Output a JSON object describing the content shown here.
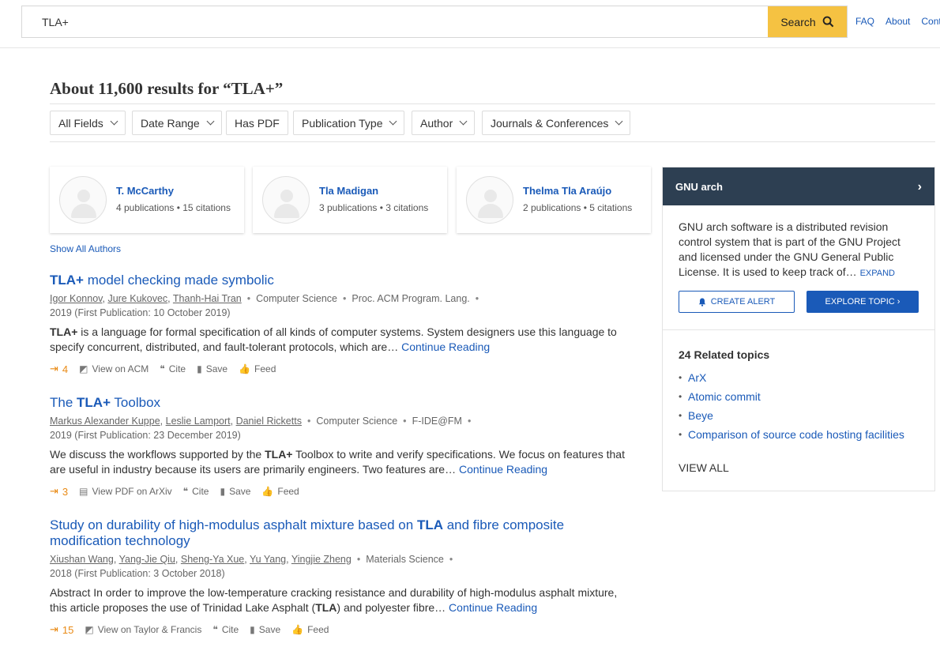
{
  "search": {
    "value": "TLA+",
    "button_label": "Search"
  },
  "topnav": [
    "FAQ",
    "About",
    "Cont"
  ],
  "results_heading": "About 11,600 results for “TLA+”",
  "filters": [
    "All Fields",
    "Date Range",
    "Has PDF",
    "Publication Type",
    "Author",
    "Journals & Conferences"
  ],
  "authors": [
    {
      "name": "T. McCarthy",
      "stats": "4 publications • 15 citations"
    },
    {
      "name": "Tla Madigan",
      "stats": "3 publications • 3 citations"
    },
    {
      "name": "Thelma Tla Araújo",
      "stats": "2 publications • 5 citations"
    }
  ],
  "show_all_authors": "Show All Authors",
  "results": [
    {
      "title_hl": "TLA+",
      "title_rest": " model checking made symbolic",
      "authors": [
        "Igor Konnov",
        "Jure Kukovec",
        "Thanh-Hai Tran"
      ],
      "field": "Computer Science",
      "venue": "Proc. ACM Program. Lang.",
      "date": "2019 (First Publication: 10 October 2019)",
      "abstract_hl": "TLA+",
      "abstract": " is a language for formal specification of all kinds of computer systems. System designers use this language to specify concurrent, distributed, and fault-tolerant protocols, which are… ",
      "continue": "Continue Reading",
      "cites": "4",
      "view": "View on ACM",
      "cite": "Cite",
      "save": "Save",
      "feed": "Feed"
    },
    {
      "title_pre": "The ",
      "title_hl": "TLA+",
      "title_rest": " Toolbox",
      "authors": [
        "Markus Alexander Kuppe",
        "Leslie Lamport",
        "Daniel Ricketts"
      ],
      "field": "Computer Science",
      "venue": "F-IDE@FM",
      "date": "2019 (First Publication: 23 December 2019)",
      "abstract_pre": "We discuss the workflows supported by the ",
      "abstract_hl": "TLA+",
      "abstract": " Toolbox to write and verify specifications. We focus on features that are useful in industry because its users are primarily engineers. Two features are… ",
      "continue": "Continue Reading",
      "cites": "3",
      "view": "View PDF on ArXiv",
      "cite": "Cite",
      "save": "Save",
      "feed": "Feed"
    },
    {
      "title_pre": "Study on durability of high-modulus asphalt mixture based on ",
      "title_hl": "TLA",
      "title_rest": " and fibre composite modification technology",
      "authors": [
        "Xiushan Wang",
        "Yang-Jie Qiu",
        "Sheng-Ya Xue",
        "Yu Yang",
        "Yingjie Zheng"
      ],
      "field": "Materials Science",
      "date": "2018 (First Publication: 3 October 2018)",
      "abstract_pre": "Abstract In order to improve the low-temperature cracking resistance and durability of high-modulus asphalt mixture, this article proposes the use of Trinidad Lake Asphalt (",
      "abstract_hl": "TLA",
      "abstract": ") and polyester fibre… ",
      "continue": "Continue Reading",
      "cites": "15",
      "view": "View on Taylor & Francis",
      "cite": "Cite",
      "save": "Save",
      "feed": "Feed"
    }
  ],
  "topic_panel": {
    "title": "GNU arch",
    "arrow": "›",
    "description": "GNU arch software is a distributed revision control system that is part of the GNU Project and licensed under the GNU General Public License. It is used to keep track of… ",
    "expand": "EXPAND",
    "create_alert": "CREATE ALERT",
    "explore": "EXPLORE TOPIC ›",
    "related_title": "24 Related topics",
    "related": [
      "ArX",
      "Atomic commit",
      "Beye",
      "Comparison of source code hosting facilities"
    ],
    "view_all": "VIEW ALL"
  },
  "colors": {
    "accent": "#1a5ab8",
    "search_button": "#f5c242",
    "topic_header": "#2d3f52",
    "citation": "#e98a15"
  }
}
